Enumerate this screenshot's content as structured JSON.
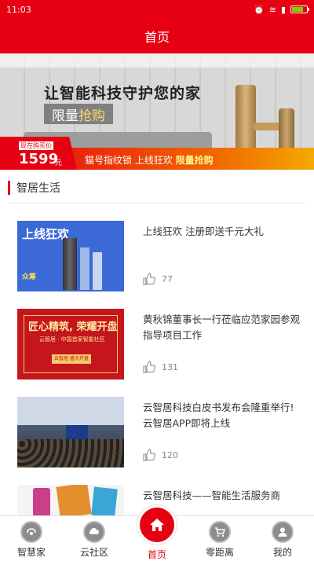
{
  "status_bar": {
    "time": "11:03"
  },
  "header": {
    "title": "首页"
  },
  "banner": {
    "headline": "让智能科技守护您的家",
    "promo_gray": "限量",
    "promo_highlight": "抢购",
    "price_hint": "现在购买价",
    "price_value": "1599",
    "price_unit": "元",
    "sale_text": "猫号指纹锁 上线狂欢 ",
    "sale_highlight": "限量抢购"
  },
  "section": {
    "title": "智居生活"
  },
  "news": [
    {
      "title": "上线狂欢 注册即送千元大礼",
      "likes": "77",
      "thumb_text": "上线狂欢",
      "thumb_badge": "众筹"
    },
    {
      "title": "黄秋锦董事长一行莅临应范家园参观指导项目工作",
      "likes": "131",
      "thumb_text": "匠心精筑, 荣耀开盘",
      "thumb_sub": "云智居 · 中国首家智能社区",
      "thumb_btn": "云智居 盛大开盘"
    },
    {
      "title": "云智居科技白皮书发布会隆重举行!云智居APP即将上线",
      "likes": "120"
    },
    {
      "title": "云智居科技——智能生活服务商"
    }
  ],
  "tabs": [
    {
      "label": "智慧家",
      "icon": "smart-home-icon"
    },
    {
      "label": "云社区",
      "icon": "cloud-community-icon"
    },
    {
      "label": "首页",
      "icon": "home-icon",
      "active": true
    },
    {
      "label": "零距离",
      "icon": "cart-icon"
    },
    {
      "label": "我的",
      "icon": "user-icon"
    }
  ],
  "colors": {
    "brand": "#e60012",
    "banner_gold": "#f5a800"
  }
}
